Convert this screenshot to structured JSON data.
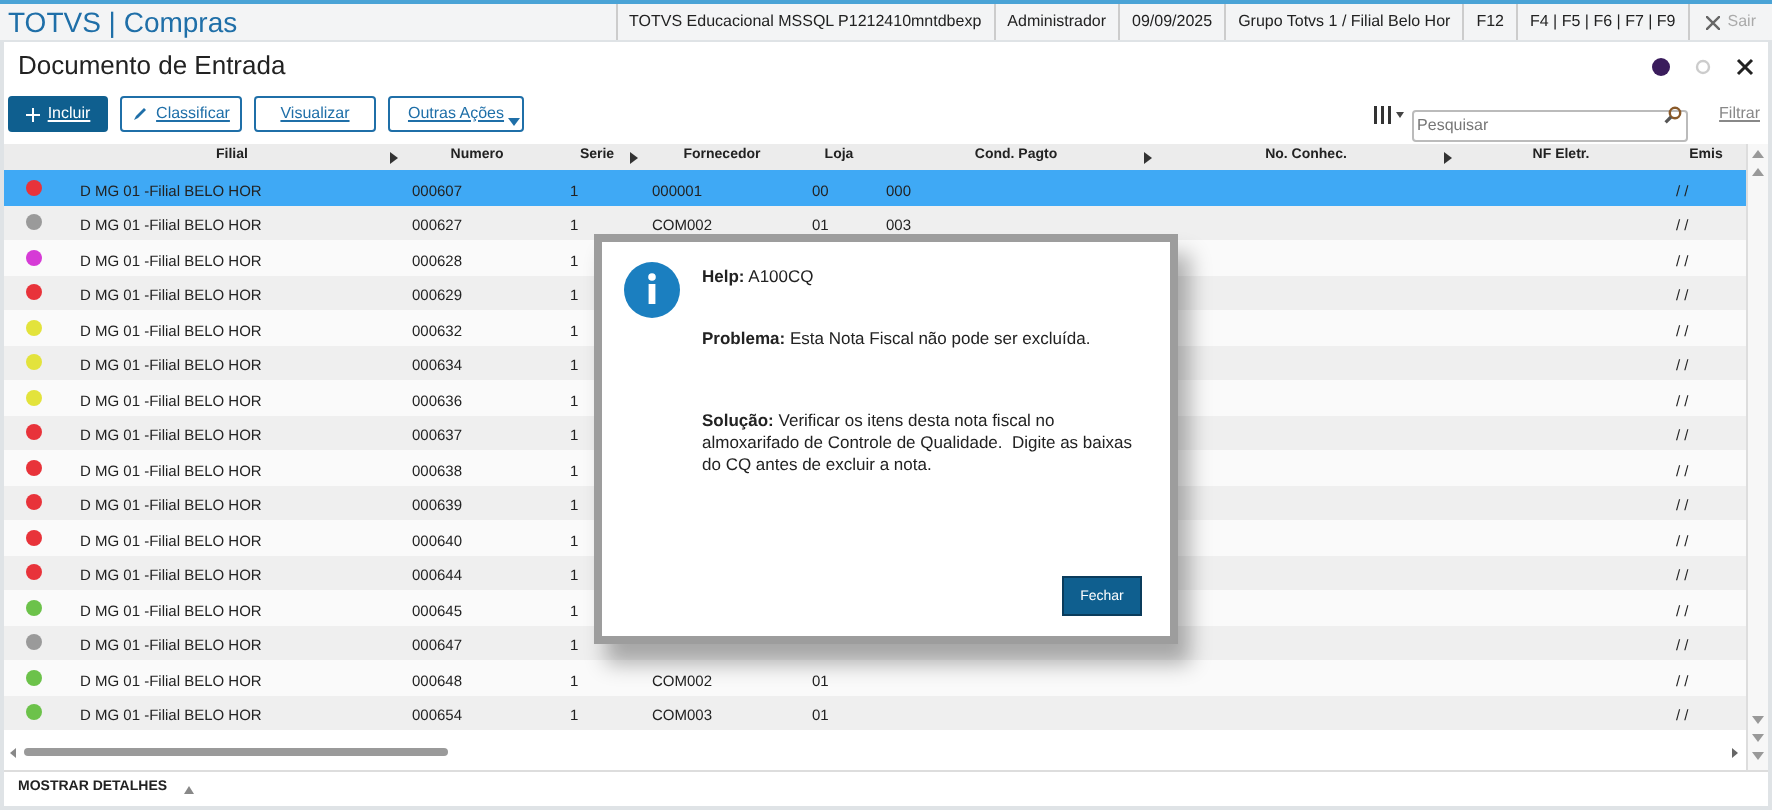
{
  "app_title": "TOTVS | Compras",
  "header_items": [
    "TOTVS Educacional MSSQL P1212410mntdbexp",
    "Administrador",
    "09/09/2025",
    "Grupo Totvs 1 / Filial Belo Hor",
    "F12",
    "F4 | F5 | F6 | F7 | F9"
  ],
  "exit_button": {
    "label": "Sair",
    "disabled": true
  },
  "page_title": "Documento de Entrada",
  "toolbar": {
    "buttons": [
      {
        "label": "Incluir",
        "kind": "primary"
      },
      {
        "label": "Classificar",
        "kind": "edit"
      },
      {
        "label": "Visualizar",
        "kind": "plain"
      },
      {
        "label": "Outras Ações",
        "kind": "menu"
      }
    ],
    "search": {
      "placeholder": "Pesquisar"
    },
    "filter_link": "Filtrar"
  },
  "table": {
    "columns": [
      {
        "label": "Filial",
        "sortable": true
      },
      {
        "label": "Numero",
        "sortable": false
      },
      {
        "label": "Serie",
        "sortable": true
      },
      {
        "label": "Fornecedor",
        "sortable": false
      },
      {
        "label": "Loja",
        "sortable": false
      },
      {
        "label": "Cond. Pagto",
        "sortable": true
      },
      {
        "label": "No. Conhec.",
        "sortable": true
      },
      {
        "label": "NF Eletr.",
        "sortable": false
      },
      {
        "label": "Emis",
        "sortable": false
      }
    ],
    "rows": [
      {
        "color": "#e8333a",
        "selected": true,
        "cells": [
          "D MG 01 -Filial BELO HOR",
          "000607",
          "1",
          "000001",
          "00",
          "000",
          "",
          "",
          "/ /"
        ]
      },
      {
        "color": "#9a9a9a",
        "selected": false,
        "cells": [
          "D MG 01 -Filial BELO HOR",
          "000627",
          "1",
          "COM002",
          "01",
          "003",
          "",
          "",
          "/ /"
        ]
      },
      {
        "color": "#d63bd6",
        "selected": false,
        "cells": [
          "D MG 01 -Filial BELO HOR",
          "000628",
          "1",
          "",
          "",
          "",
          "",
          "",
          "/ /"
        ]
      },
      {
        "color": "#e8333a",
        "selected": false,
        "cells": [
          "D MG 01 -Filial BELO HOR",
          "000629",
          "1",
          "",
          "",
          "",
          "",
          "",
          "/ /"
        ]
      },
      {
        "color": "#e3e33c",
        "selected": false,
        "cells": [
          "D MG 01 -Filial BELO HOR",
          "000632",
          "1",
          "",
          "",
          "",
          "",
          "",
          "/ /"
        ]
      },
      {
        "color": "#e3e33c",
        "selected": false,
        "cells": [
          "D MG 01 -Filial BELO HOR",
          "000634",
          "1",
          "",
          "",
          "",
          "",
          "",
          "/ /"
        ]
      },
      {
        "color": "#e3e33c",
        "selected": false,
        "cells": [
          "D MG 01 -Filial BELO HOR",
          "000636",
          "1",
          "",
          "",
          "",
          "",
          "",
          "/ /"
        ]
      },
      {
        "color": "#e8333a",
        "selected": false,
        "cells": [
          "D MG 01 -Filial BELO HOR",
          "000637",
          "1",
          "",
          "",
          "",
          "",
          "",
          "/ /"
        ]
      },
      {
        "color": "#e8333a",
        "selected": false,
        "cells": [
          "D MG 01 -Filial BELO HOR",
          "000638",
          "1",
          "",
          "",
          "",
          "",
          "",
          "/ /"
        ]
      },
      {
        "color": "#e8333a",
        "selected": false,
        "cells": [
          "D MG 01 -Filial BELO HOR",
          "000639",
          "1",
          "",
          "",
          "",
          "",
          "",
          "/ /"
        ]
      },
      {
        "color": "#e8333a",
        "selected": false,
        "cells": [
          "D MG 01 -Filial BELO HOR",
          "000640",
          "1",
          "",
          "",
          "",
          "",
          "",
          "/ /"
        ]
      },
      {
        "color": "#e8333a",
        "selected": false,
        "cells": [
          "D MG 01 -Filial BELO HOR",
          "000644",
          "1",
          "",
          "",
          "",
          "",
          "",
          "/ /"
        ]
      },
      {
        "color": "#6cc24a",
        "selected": false,
        "cells": [
          "D MG 01 -Filial BELO HOR",
          "000645",
          "1",
          "",
          "",
          "",
          "",
          "",
          "/ /"
        ]
      },
      {
        "color": "#9a9a9a",
        "selected": false,
        "cells": [
          "D MG 01 -Filial BELO HOR",
          "000647",
          "1",
          "",
          "",
          "",
          "",
          "",
          "/ /"
        ]
      },
      {
        "color": "#6cc24a",
        "selected": false,
        "cells": [
          "D MG 01 -Filial BELO HOR",
          "000648",
          "1",
          "COM002",
          "01",
          "",
          "",
          "",
          "/ /"
        ]
      },
      {
        "color": "#6cc24a",
        "selected": false,
        "cells": [
          "D MG 01 -Filial BELO HOR",
          "000654",
          "1",
          "COM003",
          "01",
          "",
          "",
          "",
          "/ /"
        ]
      }
    ]
  },
  "footer": {
    "label": "MOSTRAR DETALHES",
    "expanded": false
  },
  "dialog": {
    "title_label": "Help:",
    "title": "A100CQ",
    "problem_label": "Problema:",
    "problem": "Esta Nota Fiscal não pode ser excluída.",
    "solution_label": "Solução:",
    "solution": "Verificar os itens desta nota fiscal no almoxarifado de Controle de Qualidade.  Digite as baixas do CQ antes de excluir a nota.",
    "button": "Fechar"
  }
}
